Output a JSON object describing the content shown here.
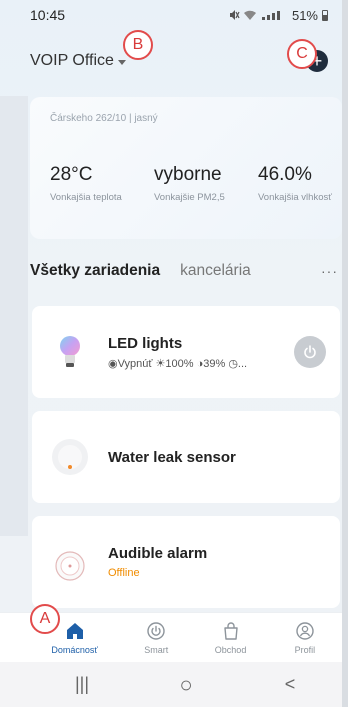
{
  "status_bar": {
    "time": "10:45",
    "battery": "51%"
  },
  "header": {
    "home_name": "VOIP Office",
    "add_label": "+"
  },
  "markers": {
    "a": "A",
    "b": "B",
    "c": "C"
  },
  "weather": {
    "location": "Čárskeho 262/10 | jasný",
    "items": [
      {
        "value": "28°C",
        "label": "Vonkajšia teplota"
      },
      {
        "value": "vyborne",
        "label": "Vonkajšie PM2,5"
      },
      {
        "value": "46.0%",
        "label": "Vonkajšia vlhkosť"
      }
    ]
  },
  "tabs": {
    "active": "Všetky zariadenia",
    "second": "kancelária",
    "more": "···"
  },
  "devices": [
    {
      "name": "LED lights",
      "status": "◉Vypnúť ☀100% ◑39% ◷..."
    },
    {
      "name": "Water leak sensor"
    },
    {
      "name": "Audible alarm",
      "status": "Offline"
    }
  ],
  "bottom_nav": [
    {
      "label": "Domácnosť",
      "icon": "home-icon",
      "active": true
    },
    {
      "label": "Smart",
      "icon": "smart-icon",
      "active": false
    },
    {
      "label": "Obchod",
      "icon": "shop-bag-icon",
      "active": false
    },
    {
      "label": "Profil",
      "icon": "profile-icon",
      "active": false
    }
  ],
  "system_nav": {
    "recents": "|||",
    "home": "○",
    "back": "<"
  },
  "colors": {
    "accent": "#1e5fa8",
    "marker": "#e24b4b",
    "offline": "#f08c00"
  }
}
